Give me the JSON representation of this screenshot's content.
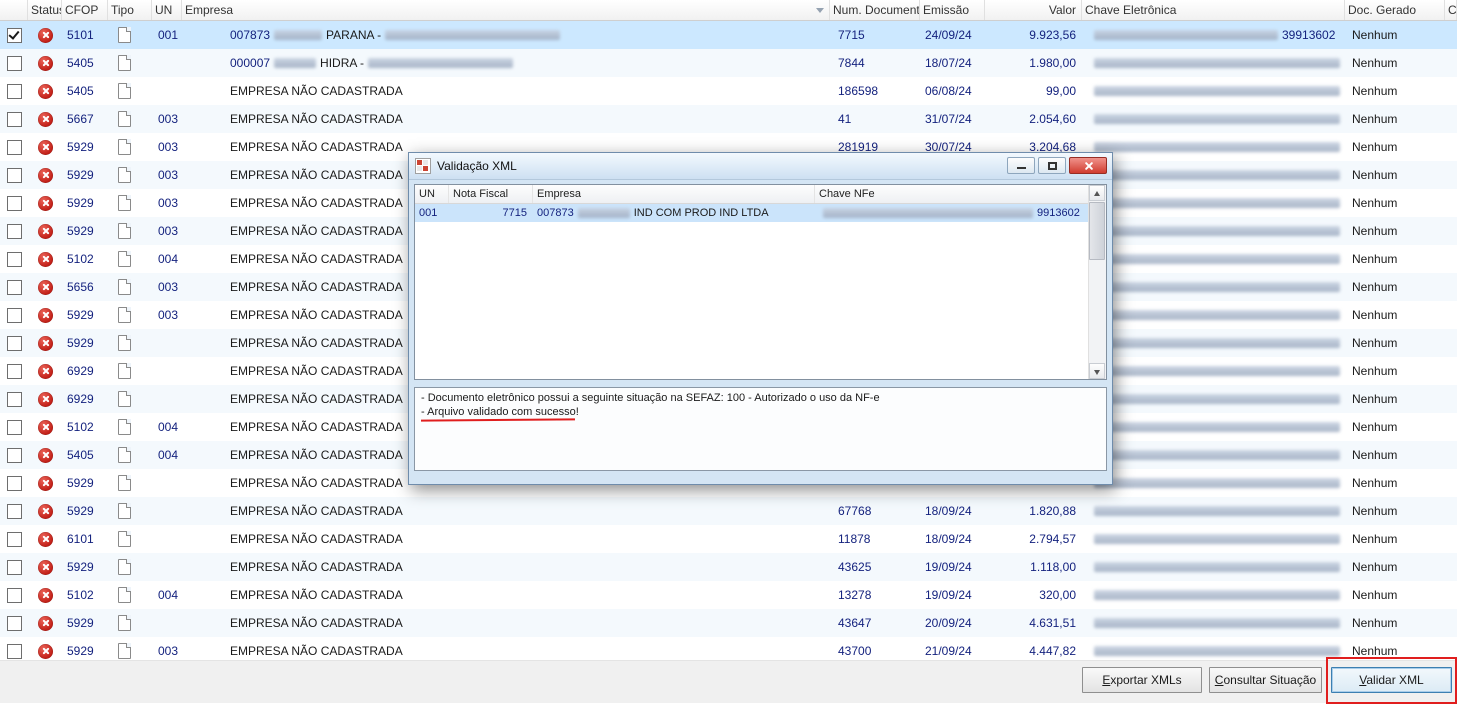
{
  "table": {
    "status_icon": "red-circle-x",
    "tipo_icon": "document-page",
    "columns": [
      {
        "id": "check",
        "label": ""
      },
      {
        "id": "status",
        "label": "Status"
      },
      {
        "id": "cfop",
        "label": "CFOP"
      },
      {
        "id": "tipo",
        "label": "Tipo"
      },
      {
        "id": "un",
        "label": "UN"
      },
      {
        "id": "empresa",
        "label": "Empresa",
        "sort": "desc"
      },
      {
        "id": "num",
        "label": "Num. Documento"
      },
      {
        "id": "emissao",
        "label": "Emissão"
      },
      {
        "id": "valor",
        "label": "Valor"
      },
      {
        "id": "chave",
        "label": "Chave Eletrônica"
      },
      {
        "id": "doc",
        "label": "Doc. Gerado"
      },
      {
        "id": "c",
        "label": "C"
      }
    ],
    "rows": [
      {
        "checked": true,
        "selected": true,
        "cfop": "5101",
        "un": "001",
        "empresa": [
          [
            "t",
            "007873"
          ],
          [
            "r",
            48
          ],
          [
            "t",
            "PARANA -"
          ],
          [
            "r",
            175
          ]
        ],
        "num": "7715",
        "emissao": "24/09/24",
        "valor": "9.923,56",
        "chave": [
          [
            "r",
            184
          ],
          [
            "t",
            "39913602"
          ]
        ],
        "doc": "Nenhum"
      },
      {
        "cfop": "5405",
        "un": "",
        "empresa": [
          [
            "t",
            "000007"
          ],
          [
            "r",
            42
          ],
          [
            "t",
            "HIDRA -"
          ],
          [
            "r",
            145
          ]
        ],
        "num": "7844",
        "emissao": "18/07/24",
        "valor": "1.980,00",
        "chave": [
          [
            "r",
            246
          ]
        ],
        "doc": "Nenhum"
      },
      {
        "cfop": "5405",
        "un": "",
        "empresa": [
          [
            "t",
            "EMPRESA NÃO CADASTRADA"
          ]
        ],
        "num": "186598",
        "emissao": "06/08/24",
        "valor": "99,00",
        "chave": [
          [
            "r",
            246
          ]
        ],
        "doc": "Nenhum"
      },
      {
        "cfop": "5667",
        "un": "003",
        "empresa": [
          [
            "t",
            "EMPRESA NÃO CADASTRADA"
          ]
        ],
        "num": "41",
        "emissao": "31/07/24",
        "valor": "2.054,60",
        "chave": [
          [
            "r",
            246
          ]
        ],
        "doc": "Nenhum"
      },
      {
        "cfop": "5929",
        "un": "003",
        "empresa": [
          [
            "t",
            "EMPRESA NÃO CADASTRADA"
          ]
        ],
        "num": "281919",
        "emissao": "30/07/24",
        "valor": "3.204,68",
        "chave": [
          [
            "r",
            246
          ]
        ],
        "doc": "Nenhum"
      },
      {
        "cfop": "5929",
        "un": "003",
        "empresa": [
          [
            "t",
            "EMPRESA NÃO CADASTRADA"
          ]
        ],
        "num": "",
        "emissao": "",
        "valor": "",
        "chave": [
          [
            "r",
            246
          ]
        ],
        "doc": "Nenhum"
      },
      {
        "cfop": "5929",
        "un": "003",
        "empresa": [
          [
            "t",
            "EMPRESA NÃO CADASTRADA"
          ]
        ],
        "num": "",
        "emissao": "",
        "valor": "",
        "chave": [
          [
            "r",
            246
          ]
        ],
        "doc": "Nenhum"
      },
      {
        "cfop": "5929",
        "un": "003",
        "empresa": [
          [
            "t",
            "EMPRESA NÃO CADASTRADA"
          ]
        ],
        "num": "",
        "emissao": "",
        "valor": "",
        "chave": [
          [
            "r",
            246
          ]
        ],
        "doc": "Nenhum"
      },
      {
        "cfop": "5102",
        "un": "004",
        "empresa": [
          [
            "t",
            "EMPRESA NÃO CADASTRADA"
          ]
        ],
        "num": "",
        "emissao": "",
        "valor": "",
        "chave": [
          [
            "r",
            246
          ]
        ],
        "doc": "Nenhum"
      },
      {
        "cfop": "5656",
        "un": "003",
        "empresa": [
          [
            "t",
            "EMPRESA NÃO CADASTRADA"
          ]
        ],
        "num": "",
        "emissao": "",
        "valor": "",
        "chave": [
          [
            "r",
            246
          ]
        ],
        "doc": "Nenhum"
      },
      {
        "cfop": "5929",
        "un": "003",
        "empresa": [
          [
            "t",
            "EMPRESA NÃO CADASTRADA"
          ]
        ],
        "num": "",
        "emissao": "",
        "valor": "",
        "chave": [
          [
            "r",
            246
          ]
        ],
        "doc": "Nenhum"
      },
      {
        "cfop": "5929",
        "un": "",
        "empresa": [
          [
            "t",
            "EMPRESA NÃO CADASTRADA"
          ]
        ],
        "num": "",
        "emissao": "",
        "valor": "",
        "chave": [
          [
            "r",
            246
          ]
        ],
        "doc": "Nenhum"
      },
      {
        "cfop": "6929",
        "un": "",
        "empresa": [
          [
            "t",
            "EMPRESA NÃO CADASTRADA"
          ]
        ],
        "num": "",
        "emissao": "",
        "valor": "",
        "chave": [
          [
            "r",
            246
          ]
        ],
        "doc": "Nenhum"
      },
      {
        "cfop": "6929",
        "un": "",
        "empresa": [
          [
            "t",
            "EMPRESA NÃO CADASTRADA"
          ]
        ],
        "num": "",
        "emissao": "",
        "valor": "",
        "chave": [
          [
            "r",
            246
          ]
        ],
        "doc": "Nenhum"
      },
      {
        "cfop": "5102",
        "un": "004",
        "empresa": [
          [
            "t",
            "EMPRESA NÃO CADASTRADA"
          ]
        ],
        "num": "",
        "emissao": "",
        "valor": "",
        "chave": [
          [
            "r",
            246
          ]
        ],
        "doc": "Nenhum"
      },
      {
        "cfop": "5405",
        "un": "004",
        "empresa": [
          [
            "t",
            "EMPRESA NÃO CADASTRADA"
          ]
        ],
        "num": "",
        "emissao": "",
        "valor": "",
        "chave": [
          [
            "r",
            246
          ]
        ],
        "doc": "Nenhum"
      },
      {
        "cfop": "5929",
        "un": "",
        "empresa": [
          [
            "t",
            "EMPRESA NÃO CADASTRADA"
          ]
        ],
        "num": "",
        "emissao": "",
        "valor": "",
        "chave": [
          [
            "r",
            246
          ]
        ],
        "doc": "Nenhum"
      },
      {
        "cfop": "5929",
        "un": "",
        "empresa": [
          [
            "t",
            "EMPRESA NÃO CADASTRADA"
          ]
        ],
        "num": "67768",
        "emissao": "18/09/24",
        "valor": "1.820,88",
        "chave": [
          [
            "r",
            246
          ]
        ],
        "doc": "Nenhum"
      },
      {
        "cfop": "6101",
        "un": "",
        "empresa": [
          [
            "t",
            "EMPRESA NÃO CADASTRADA"
          ]
        ],
        "num": "11878",
        "emissao": "18/09/24",
        "valor": "2.794,57",
        "chave": [
          [
            "r",
            246
          ]
        ],
        "doc": "Nenhum"
      },
      {
        "cfop": "5929",
        "un": "",
        "empresa": [
          [
            "t",
            "EMPRESA NÃO CADASTRADA"
          ]
        ],
        "num": "43625",
        "emissao": "19/09/24",
        "valor": "1.118,00",
        "chave": [
          [
            "r",
            246
          ]
        ],
        "doc": "Nenhum"
      },
      {
        "cfop": "5102",
        "un": "004",
        "empresa": [
          [
            "t",
            "EMPRESA NÃO CADASTRADA"
          ]
        ],
        "num": "13278",
        "emissao": "19/09/24",
        "valor": "320,00",
        "chave": [
          [
            "r",
            246
          ]
        ],
        "doc": "Nenhum"
      },
      {
        "cfop": "5929",
        "un": "",
        "empresa": [
          [
            "t",
            "EMPRESA NÃO CADASTRADA"
          ]
        ],
        "num": "43647",
        "emissao": "20/09/24",
        "valor": "4.631,51",
        "chave": [
          [
            "r",
            246
          ]
        ],
        "doc": "Nenhum"
      },
      {
        "cfop": "5929",
        "un": "003",
        "empresa": [
          [
            "t",
            "EMPRESA NÃO CADASTRADA"
          ]
        ],
        "num": "43700",
        "emissao": "21/09/24",
        "valor": "4.447,82",
        "chave": [
          [
            "r",
            246
          ]
        ],
        "doc": "Nenhum"
      }
    ]
  },
  "dialog": {
    "title": "Validação XML",
    "columns": [
      "UN",
      "Nota Fiscal",
      "Empresa",
      "Chave NFe"
    ],
    "result_row": {
      "un": "001",
      "nota_fiscal": "7715",
      "empresa_code": "007873",
      "empresa_name": "IND COM PROD IND LTDA",
      "chave_suffix": "9913602"
    },
    "messages": [
      "- Documento eletrônico possui a seguinte situação na SEFAZ: 100 - Autorizado o uso da NF-e",
      "- Arquivo validado com sucesso!"
    ]
  },
  "footer": {
    "buttons": [
      {
        "id": "export",
        "label": "Exportar XMLs",
        "accel": 0
      },
      {
        "id": "consult",
        "label": "Consultar Situação",
        "accel": 0
      },
      {
        "id": "validate",
        "label": "Validar XML",
        "accel": 0,
        "highlighted": true
      }
    ]
  },
  "colors": {
    "selection": "#cce8ff",
    "annotation_red": "#e01e1e",
    "status_red": "#c21f17",
    "navy_text": "#14227e"
  }
}
